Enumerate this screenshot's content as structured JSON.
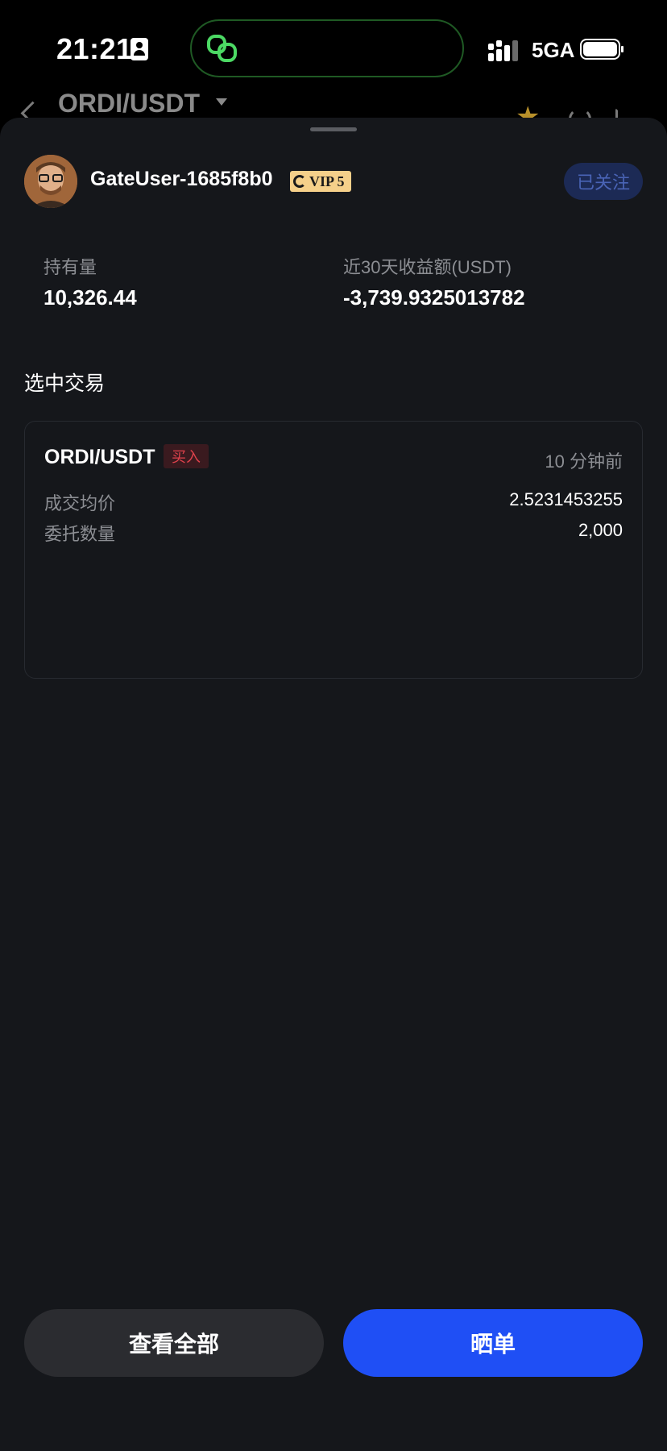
{
  "status_bar": {
    "time": "21:21",
    "network": "5GA",
    "icons": [
      "contact-card-icon",
      "link-icon",
      "signal-icon",
      "battery-icon"
    ]
  },
  "background_header": {
    "pair": "ORDI/USDT",
    "icons": [
      "back-icon",
      "caret-down-icon",
      "star-icon",
      "refresh-icon",
      "share-icon"
    ]
  },
  "profile": {
    "username": "GateUser-1685f8b0",
    "vip": "VIP 5",
    "follow_label": "已关注"
  },
  "stats": {
    "holding_label": "持有量",
    "holding_value": "10,326.44",
    "pnl_label": "近30天收益额(USDT)",
    "pnl_value": "-3,739.9325013782"
  },
  "selected_trade": {
    "section_title": "选中交易",
    "pair": "ORDI/USDT",
    "side": "买入",
    "time": "10 分钟前",
    "rows": [
      {
        "label": "成交均价",
        "value": "2.5231453255"
      },
      {
        "label": "委托数量",
        "value": "2,000"
      }
    ]
  },
  "actions": {
    "view_all_label": "查看全部",
    "share_label": "晒单"
  },
  "colors": {
    "sheet_bg": "#15171b",
    "primary": "#1f4ff5",
    "vip_gold": "#f5d08a",
    "buy_red": "#e0424c",
    "muted_text": "#8c8e93"
  }
}
